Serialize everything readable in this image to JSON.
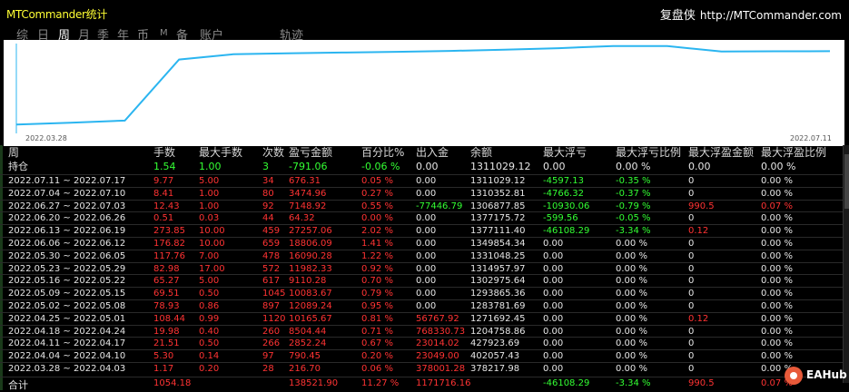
{
  "header": {
    "title": "MTCommander统计",
    "site_name": "复盘侠",
    "site_url": "http://MTCommander.com"
  },
  "tabs": [
    {
      "label": "综",
      "active": false
    },
    {
      "label": "日",
      "active": false
    },
    {
      "label": "周",
      "active": true
    },
    {
      "label": "月",
      "active": false
    },
    {
      "label": "季",
      "active": false
    },
    {
      "label": "年",
      "active": false
    },
    {
      "label": "币",
      "active": false
    },
    {
      "label": "M",
      "active": false
    },
    {
      "label": "备",
      "active": false
    },
    {
      "label": "账户",
      "active": false
    },
    {
      "label": "轨迹",
      "active": false
    }
  ],
  "chart": {
    "start_label": "2022.03.28",
    "end_label": "2022.07.11",
    "line_color": "#2bb5f0",
    "balance": [
      378217.98,
      402057.43,
      427923.69,
      1204758.86,
      1271692.45,
      1283781.69,
      1293865.36,
      1302975.64,
      1314957.97,
      1331048.25,
      1349854.34,
      1377111.4,
      1377175.72,
      1306877.85,
      1310352.81,
      1311029.12
    ]
  },
  "table": {
    "columns": [
      "周",
      "手数",
      "最大手数",
      "次数",
      "盈亏金额",
      "百分比%",
      "出入金",
      "余额",
      "最大浮亏",
      "最大浮亏比例",
      "最大浮盈金额",
      "最大浮盈比例"
    ],
    "holding": {
      "label": "持仓",
      "lots": "1.54",
      "max_lots": "1.00",
      "count": "3",
      "pnl": "-791.06",
      "pct": "-0.06 %",
      "inout": "0.00",
      "balance": "1311029.12",
      "max_float_loss": "0.00",
      "max_float_loss_pct": "0.00 %",
      "max_float_profit": "0.00",
      "max_float_profit_pct": "0.00 %"
    },
    "rows": [
      {
        "week": "2022.07.11 ~ 2022.07.17",
        "lots": "9.77",
        "max_lots": "5.00",
        "count": "34",
        "pnl": "676.31",
        "pct": "0.05 %",
        "inout": "0.00",
        "balance": "1311029.12",
        "fl": "-4597.13",
        "flp": "-0.35 %",
        "fp": "0",
        "fpp": "0.00 %"
      },
      {
        "week": "2022.07.04 ~ 2022.07.10",
        "lots": "8.41",
        "max_lots": "1.00",
        "count": "80",
        "pnl": "3474.96",
        "pct": "0.27 %",
        "inout": "0.00",
        "balance": "1310352.81",
        "fl": "-4766.32",
        "flp": "-0.37 %",
        "fp": "0",
        "fpp": "0.00 %"
      },
      {
        "week": "2022.06.27 ~ 2022.07.03",
        "lots": "12.43",
        "max_lots": "1.00",
        "count": "92",
        "pnl": "7148.92",
        "pct": "0.55 %",
        "inout": "-77446.79",
        "balance": "1306877.85",
        "fl": "-10930.06",
        "flp": "-0.79 %",
        "fp": "990.5",
        "fpp": "0.07 %"
      },
      {
        "week": "2022.06.20 ~ 2022.06.26",
        "lots": "0.51",
        "max_lots": "0.03",
        "count": "44",
        "pnl": "64.32",
        "pct": "0.00 %",
        "inout": "0.00",
        "balance": "1377175.72",
        "fl": "-599.56",
        "flp": "-0.05 %",
        "fp": "0",
        "fpp": "0.00 %"
      },
      {
        "week": "2022.06.13 ~ 2022.06.19",
        "lots": "273.85",
        "max_lots": "10.00",
        "count": "459",
        "pnl": "27257.06",
        "pct": "2.02 %",
        "inout": "0.00",
        "balance": "1377111.40",
        "fl": "-46108.29",
        "flp": "-3.34 %",
        "fp": "0.12",
        "fpp": "0.00 %"
      },
      {
        "week": "2022.06.06 ~ 2022.06.12",
        "lots": "176.82",
        "max_lots": "10.00",
        "count": "659",
        "pnl": "18806.09",
        "pct": "1.41 %",
        "inout": "0.00",
        "balance": "1349854.34",
        "fl": "0.00",
        "flp": "0.00 %",
        "fp": "0",
        "fpp": "0.00 %"
      },
      {
        "week": "2022.05.30 ~ 2022.06.05",
        "lots": "117.76",
        "max_lots": "7.00",
        "count": "478",
        "pnl": "16090.28",
        "pct": "1.22 %",
        "inout": "0.00",
        "balance": "1331048.25",
        "fl": "0.00",
        "flp": "0.00 %",
        "fp": "0",
        "fpp": "0.00 %"
      },
      {
        "week": "2022.05.23 ~ 2022.05.29",
        "lots": "82.98",
        "max_lots": "17.00",
        "count": "572",
        "pnl": "11982.33",
        "pct": "0.92 %",
        "inout": "0.00",
        "balance": "1314957.97",
        "fl": "0.00",
        "flp": "0.00 %",
        "fp": "0",
        "fpp": "0.00 %"
      },
      {
        "week": "2022.05.16 ~ 2022.05.22",
        "lots": "65.27",
        "max_lots": "5.00",
        "count": "617",
        "pnl": "9110.28",
        "pct": "0.70 %",
        "inout": "0.00",
        "balance": "1302975.64",
        "fl": "0.00",
        "flp": "0.00 %",
        "fp": "0",
        "fpp": "0.00 %"
      },
      {
        "week": "2022.05.09 ~ 2022.05.15",
        "lots": "69.51",
        "max_lots": "0.50",
        "count": "1045",
        "pnl": "10083.67",
        "pct": "0.79 %",
        "inout": "0.00",
        "balance": "1293865.36",
        "fl": "0.00",
        "flp": "0.00 %",
        "fp": "0",
        "fpp": "0.00 %"
      },
      {
        "week": "2022.05.02 ~ 2022.05.08",
        "lots": "78.93",
        "max_lots": "0.86",
        "count": "897",
        "pnl": "12089.24",
        "pct": "0.95 %",
        "inout": "0.00",
        "balance": "1283781.69",
        "fl": "0.00",
        "flp": "0.00 %",
        "fp": "0",
        "fpp": "0.00 %"
      },
      {
        "week": "2022.04.25 ~ 2022.05.01",
        "lots": "108.44",
        "max_lots": "0.99",
        "count": "1120",
        "pnl": "10165.67",
        "pct": "0.81 %",
        "inout": "56767.92",
        "balance": "1271692.45",
        "fl": "0.00",
        "flp": "0.00 %",
        "fp": "0.12",
        "fpp": "0.00 %"
      },
      {
        "week": "2022.04.18 ~ 2022.04.24",
        "lots": "19.98",
        "max_lots": "0.40",
        "count": "260",
        "pnl": "8504.44",
        "pct": "0.71 %",
        "inout": "768330.73",
        "balance": "1204758.86",
        "fl": "0.00",
        "flp": "0.00 %",
        "fp": "0",
        "fpp": "0.00 %"
      },
      {
        "week": "2022.04.11 ~ 2022.04.17",
        "lots": "21.51",
        "max_lots": "0.50",
        "count": "266",
        "pnl": "2852.24",
        "pct": "0.67 %",
        "inout": "23014.02",
        "balance": "427923.69",
        "fl": "0.00",
        "flp": "0.00 %",
        "fp": "0",
        "fpp": "0.00 %"
      },
      {
        "week": "2022.04.04 ~ 2022.04.10",
        "lots": "5.30",
        "max_lots": "0.14",
        "count": "97",
        "pnl": "790.45",
        "pct": "0.20 %",
        "inout": "23049.00",
        "balance": "402057.43",
        "fl": "0.00",
        "flp": "0.00 %",
        "fp": "0",
        "fpp": "0.00 %"
      },
      {
        "week": "2022.03.28 ~ 2022.04.03",
        "lots": "1.17",
        "max_lots": "0.20",
        "count": "28",
        "pnl": "216.70",
        "pct": "0.06 %",
        "inout": "378001.28",
        "balance": "378217.98",
        "fl": "0.00",
        "flp": "0.00 %",
        "fp": "0",
        "fpp": "0.00 %"
      }
    ],
    "total": {
      "label": "合计",
      "lots": "1054.18",
      "pnl": "138521.90",
      "pct": "11.27 %",
      "inout": "1171716.16",
      "fl": "-46108.29",
      "flp": "-3.34 %",
      "fp": "990.5",
      "fpp": "0.07 %"
    }
  },
  "watermark": {
    "text": "EAHub"
  },
  "colors": {
    "positive": "#ff3333",
    "negative": "#33ff33",
    "title": "#ffff33",
    "line": "#2bb5f0"
  }
}
